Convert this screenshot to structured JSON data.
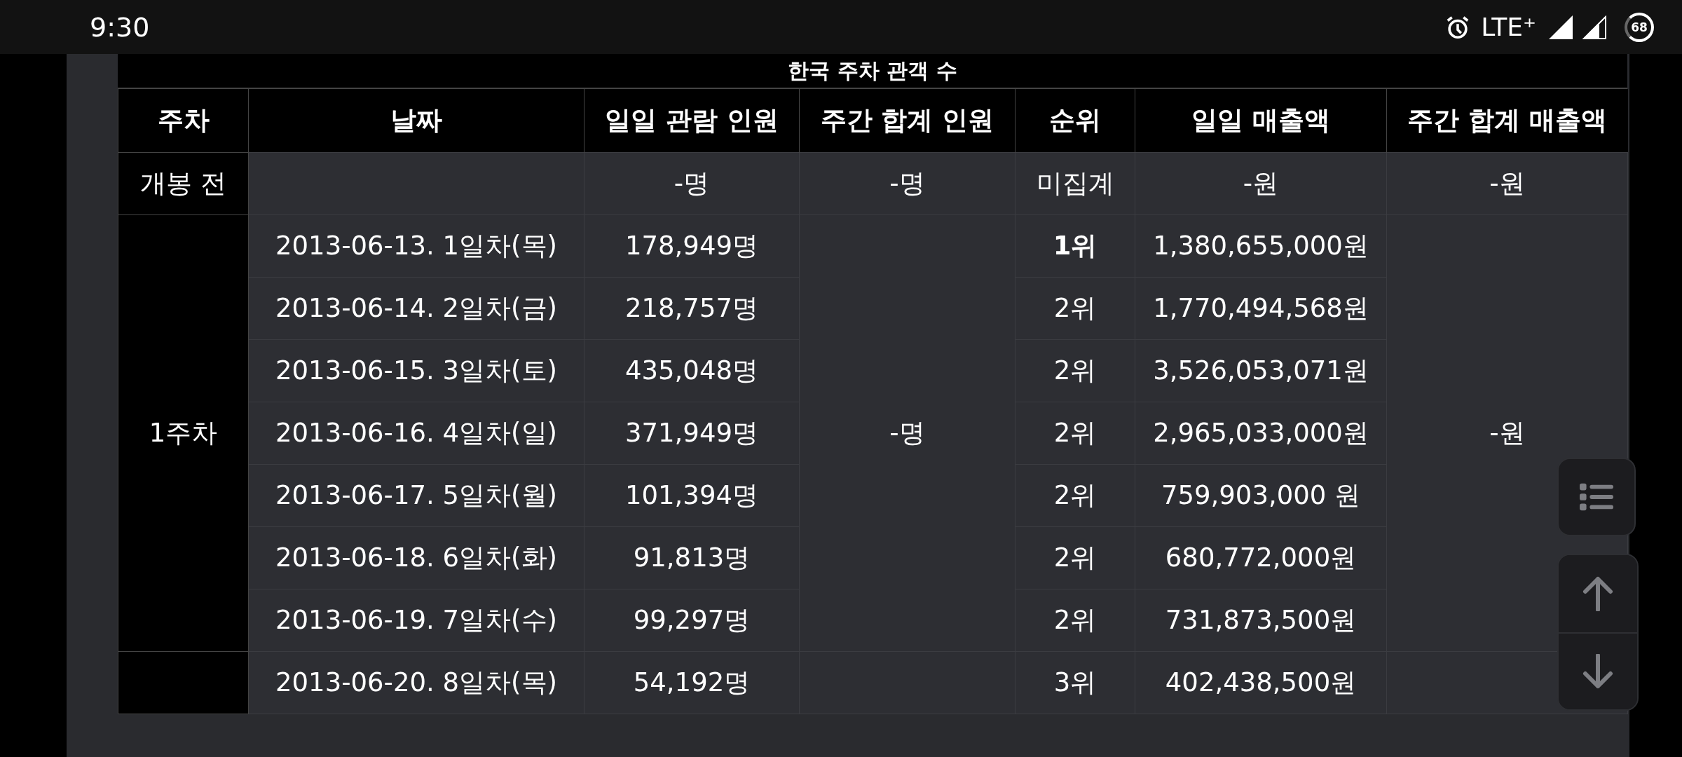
{
  "status_bar": {
    "time": "9:30",
    "network": "LTE⁺",
    "battery": "68"
  },
  "table": {
    "title": "한국 주차 관객 수",
    "columns": [
      "주차",
      "날짜",
      "일일 관람 인원",
      "주간 합계 인원",
      "순위",
      "일일 매출액",
      "주간 합계 매출액"
    ],
    "pre_release": {
      "label": "개봉 전",
      "daily_viewers": "-명",
      "weekly_viewers": "-명",
      "rank": "미집계",
      "daily_revenue": "-원",
      "weekly_revenue": "-원"
    },
    "weeks": [
      {
        "label": "1주차",
        "weekly_viewers": "-명",
        "weekly_revenue": "-원",
        "days": [
          {
            "date": "2013-06-13. 1일차(목)",
            "daily_viewers": "178,949명",
            "rank": "1위",
            "bold": true,
            "daily_revenue": "1,380,655,000원"
          },
          {
            "date": "2013-06-14. 2일차(금)",
            "daily_viewers": "218,757명",
            "rank": "2위",
            "bold": false,
            "daily_revenue": "1,770,494,568원"
          },
          {
            "date": "2013-06-15. 3일차(토)",
            "daily_viewers": "435,048명",
            "rank": "2위",
            "bold": false,
            "daily_revenue": "3,526,053,071원"
          },
          {
            "date": "2013-06-16. 4일차(일)",
            "daily_viewers": "371,949명",
            "rank": "2위",
            "bold": false,
            "daily_revenue": "2,965,033,000원"
          },
          {
            "date": "2013-06-17. 5일차(월)",
            "daily_viewers": "101,394명",
            "rank": "2위",
            "bold": false,
            "daily_revenue": "759,903,000 원"
          },
          {
            "date": "2013-06-18. 6일차(화)",
            "daily_viewers": "91,813명",
            "rank": "2위",
            "bold": false,
            "daily_revenue": "680,772,000원"
          },
          {
            "date": "2013-06-19. 7일차(수)",
            "daily_viewers": "99,297명",
            "rank": "2위",
            "bold": false,
            "daily_revenue": "731,873,500원"
          }
        ]
      },
      {
        "days": [
          {
            "date": "2013-06-20. 8일차(목)",
            "daily_viewers": "54,192명",
            "rank": "3위",
            "bold": false,
            "daily_revenue": "402,438,500원"
          }
        ]
      }
    ]
  }
}
